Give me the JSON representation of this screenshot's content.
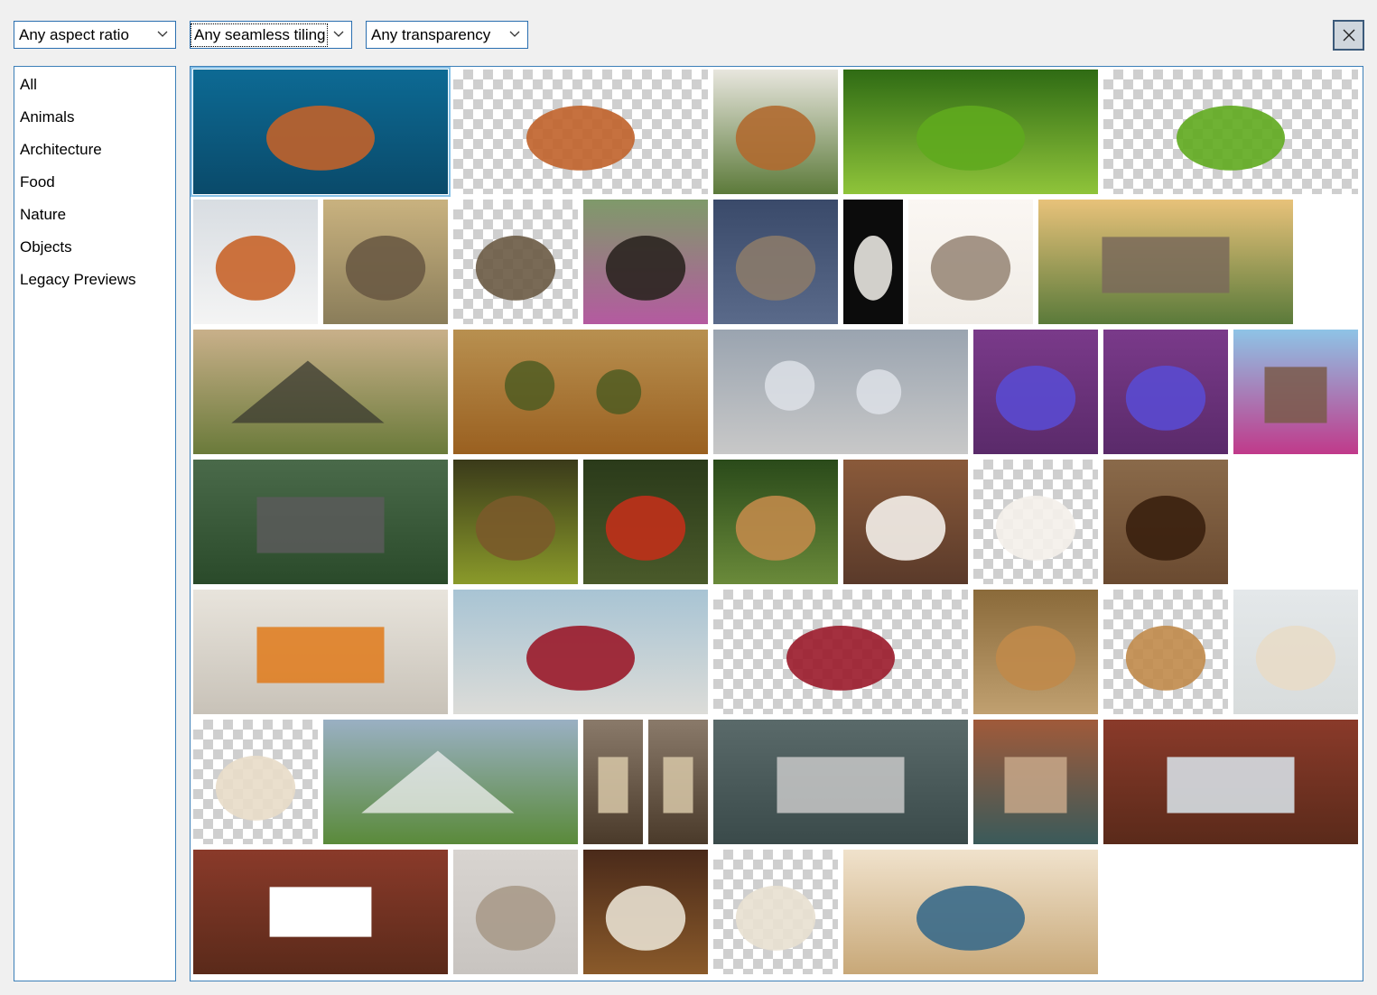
{
  "filters": {
    "aspect_ratio": "Any aspect ratio",
    "seamless_tiling": "Any seamless tiling",
    "transparency": "Any transparency"
  },
  "icons": {
    "close": "close-icon",
    "dropdown": "chevron-down-icon"
  },
  "categories": [
    "All",
    "Animals",
    "Architecture",
    "Food",
    "Nature",
    "Objects",
    "Legacy Previews"
  ],
  "thumbnails": [
    "sea-turtle",
    "sea-turtle-transparent",
    "dog-in-meadow",
    "green-frog",
    "green-frog-transparent",
    "fox-in-snow",
    "owls-on-stump",
    "owls-on-stump-transparent",
    "blackbird",
    "owl-on-branch",
    "white-horse",
    "kitten",
    "boardwalk-sunrise",
    "mountain-coast",
    "autumn-olive-trees",
    "frosted-forest-path",
    "purple-iris",
    "purple-iris-copy",
    "meadow-house",
    "forest-road",
    "mushroom-basket",
    "red-toadstool",
    "small-mushroom",
    "coffee-cup",
    "coffee-cup-transparent",
    "coffee-beans",
    "vegetable-skewers",
    "cherry-basket",
    "cherry-basket-transparent",
    "muffins",
    "muffins-transparent",
    "fig-smoothie",
    "fig-smoothie-transparent",
    "alpine-church",
    "street-buildings",
    "street-buildings-mirrored",
    "aerial-city",
    "venice-canal",
    "courtyard-looking-up",
    "courtyard-transparent",
    "rose-window",
    "venetian-masks",
    "venetian-mask-transparent",
    "glass-marbles"
  ],
  "colors": {
    "accent": "#2a6fb0",
    "selection": "#8ac3e8",
    "background": "#f0f0f0"
  }
}
